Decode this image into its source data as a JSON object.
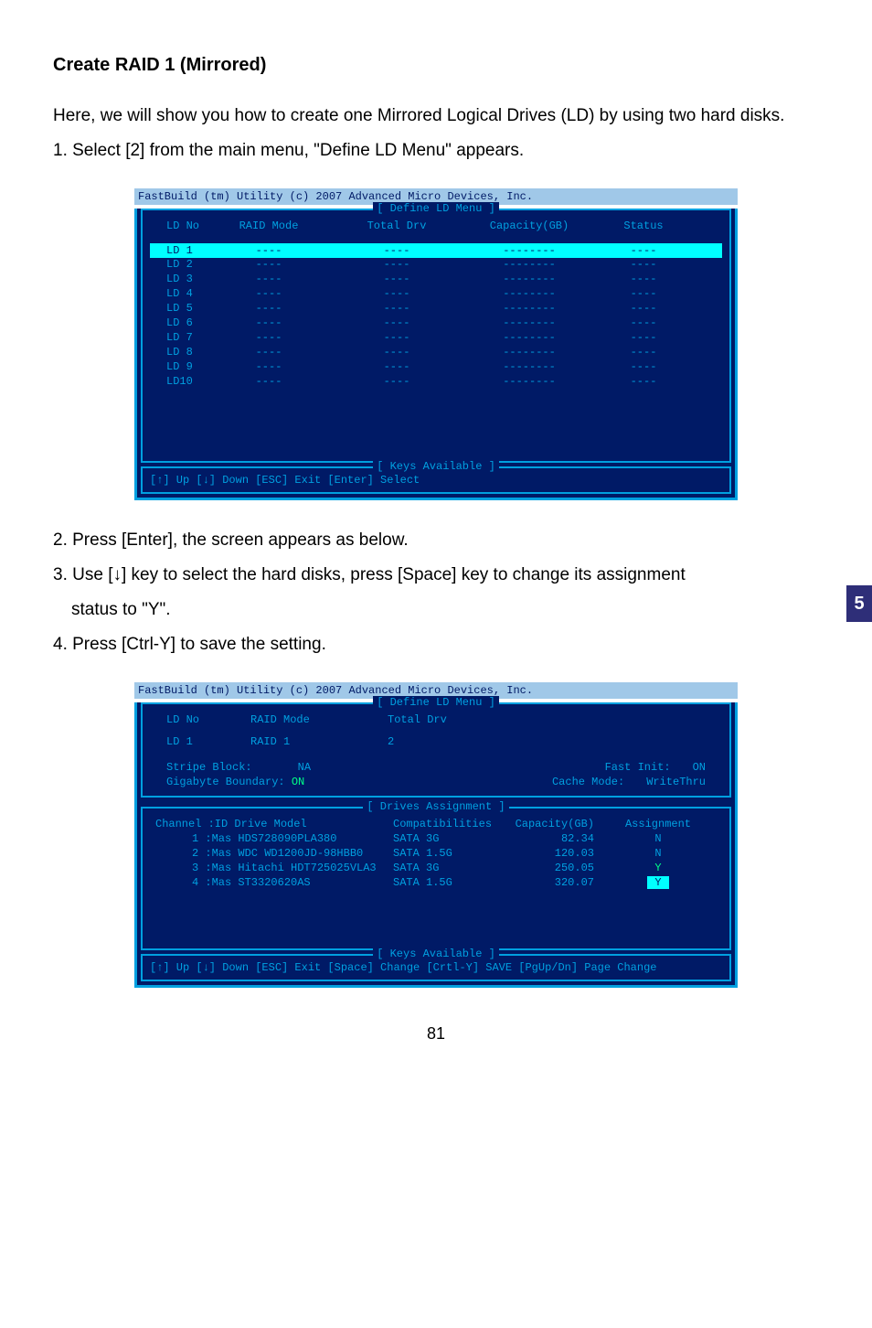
{
  "side_tab": "5",
  "heading": "Create RAID 1 (Mirrored)",
  "intro": "Here, we will show you how to create one Mirrored Logical Drives (LD) by using two hard disks.",
  "step1": "1. Select [2] from the main menu, \"Define LD Menu\" appears.",
  "bios1": {
    "banner": "FastBuild (tm) Utility (c) 2007 Advanced Micro Devices, Inc.",
    "title": "[ Define LD Menu ]",
    "headers": {
      "ld": "LD No",
      "raid": "RAID Mode",
      "total": "Total Drv",
      "cap": "Capacity(GB)",
      "status": "Status"
    },
    "rows": [
      {
        "ld": "LD  1",
        "raid": "----",
        "total": "----",
        "cap": "--------",
        "status": "----",
        "selected": true
      },
      {
        "ld": "LD  2",
        "raid": "----",
        "total": "----",
        "cap": "--------",
        "status": "----"
      },
      {
        "ld": "LD  3",
        "raid": "----",
        "total": "----",
        "cap": "--------",
        "status": "----"
      },
      {
        "ld": "LD  4",
        "raid": "----",
        "total": "----",
        "cap": "--------",
        "status": "----"
      },
      {
        "ld": "LD  5",
        "raid": "----",
        "total": "----",
        "cap": "--------",
        "status": "----"
      },
      {
        "ld": "LD  6",
        "raid": "----",
        "total": "----",
        "cap": "--------",
        "status": "----"
      },
      {
        "ld": "LD  7",
        "raid": "----",
        "total": "----",
        "cap": "--------",
        "status": "----"
      },
      {
        "ld": "LD  8",
        "raid": "----",
        "total": "----",
        "cap": "--------",
        "status": "----"
      },
      {
        "ld": "LD  9",
        "raid": "----",
        "total": "----",
        "cap": "--------",
        "status": "----"
      },
      {
        "ld": "LD10",
        "raid": "----",
        "total": "----",
        "cap": "--------",
        "status": "----"
      }
    ],
    "keys_title": "[ Keys Available ]",
    "footer": "[↑] Up    [↓] Down    [ESC] Exit    [Enter] Select"
  },
  "step2": "2. Press [Enter], the screen appears as below.",
  "step3a": "3. Use [↓] key to select the hard disks, press [Space] key to change its assignment",
  "step3b": "status to \"Y\".",
  "step4": "4. Press [Ctrl-Y] to save the setting.",
  "bios2": {
    "banner": "FastBuild (tm) Utility (c) 2007 Advanced Micro Devices, Inc.",
    "title": "[ Define LD Menu ]",
    "headers": {
      "ld": "LD No",
      "raid": "RAID Mode",
      "total": "Total Drv"
    },
    "row": {
      "ld": "LD  1",
      "raid": "RAID 1",
      "total": "2"
    },
    "opts": {
      "stripe_block_label": "Stripe Block:",
      "stripe_block_val": "NA",
      "gigabyte_label": "Gigabyte Boundary:",
      "gigabyte_val": "ON",
      "fast_init_label": "Fast Init:",
      "fast_init_val": "ON",
      "cache_mode_label": "Cache Mode:",
      "cache_mode_val": "WriteThru"
    },
    "drives_title": "[ Drives Assignment ]",
    "drives_headers": {
      "chan": "Channel :ID   Drive Model",
      "compat": "Compatibilities",
      "cap": "Capacity(GB)",
      "assign": "Assignment"
    },
    "drives": [
      {
        "model": "1 :Mas HDS728090PLA380",
        "compat": "SATA  3G",
        "cap": "82.34",
        "assign": "N"
      },
      {
        "model": "2 :Mas WDC WD1200JD-98HBB0",
        "compat": "SATA  1.5G",
        "cap": "120.03",
        "assign": "N"
      },
      {
        "model": "3 :Mas Hitachi HDT725025VLA3",
        "compat": "SATA  3G",
        "cap": "250.05",
        "assign": "Y"
      },
      {
        "model": "4 :Mas ST3320620AS",
        "compat": "SATA  1.5G",
        "cap": "320.07",
        "assign": "Y",
        "selected": true
      }
    ],
    "keys_title": "[ Keys Available ]",
    "footer": "[↑] Up  [↓] Down  [ESC] Exit  [Space] Change  [Crtl-Y] SAVE   [PgUp/Dn] Page Change"
  },
  "page_number": "81"
}
